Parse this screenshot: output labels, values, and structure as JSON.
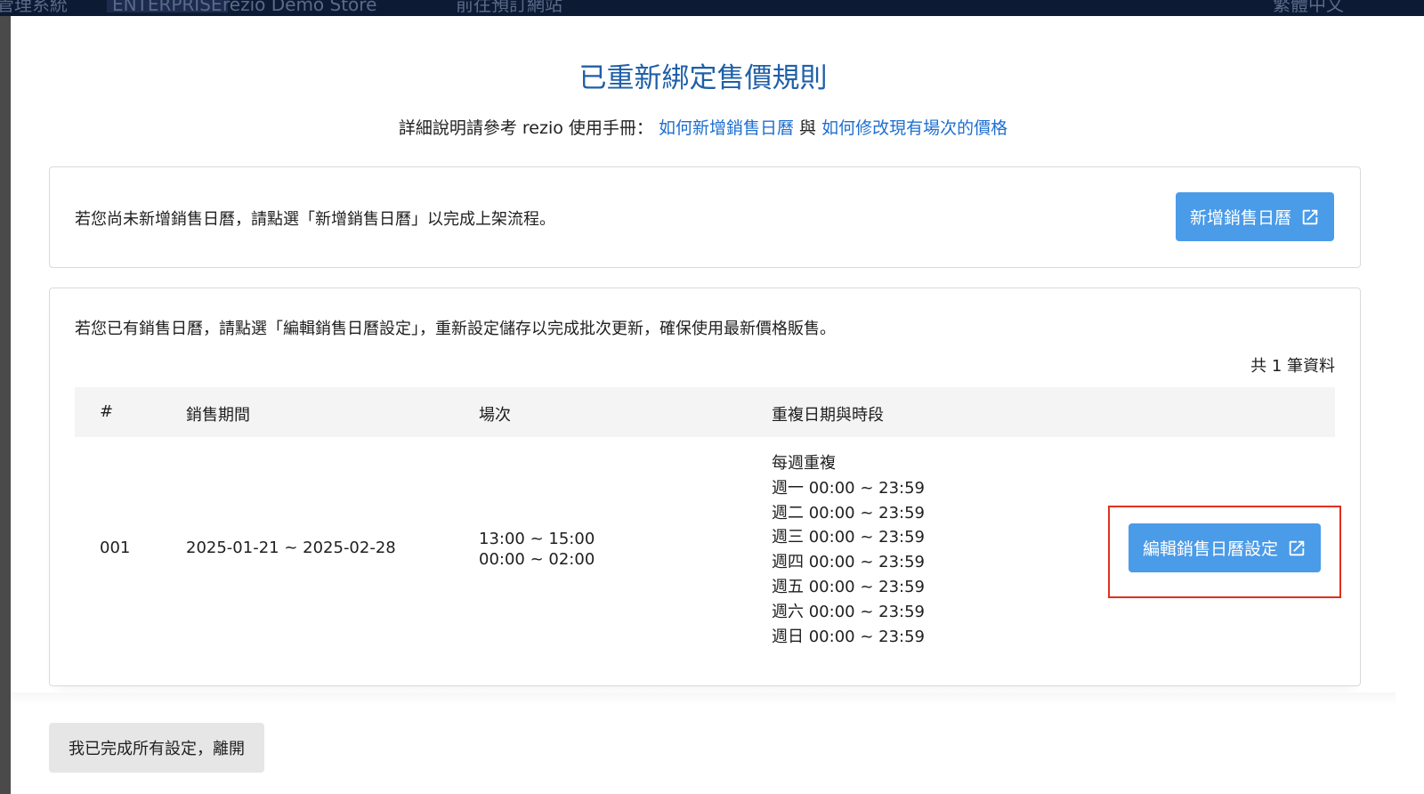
{
  "background": {
    "app_name": "管理系統",
    "plan_badge": "ENTERPRISE",
    "store_name": "rezio Demo Store",
    "goto_site": "前往預訂網站",
    "language": "繁體中文"
  },
  "modal": {
    "title": "已重新綁定售價規則",
    "subtitle_prefix": "詳細說明請參考 rezio 使用手冊：",
    "link_new_calendar": "如何新增銷售日曆",
    "subtitle_and": "與",
    "link_modify_price": "如何修改現有場次的價格"
  },
  "card_new": {
    "text": "若您尚未新增銷售日曆，請點選「新增銷售日曆」以完成上架流程。",
    "button_label": "新增銷售日曆"
  },
  "card_edit": {
    "text": "若您已有銷售日曆，請點選「編輯銷售日曆設定」，重新設定儲存以完成批次更新，確保使用最新價格販售。",
    "count": "共 1 筆資料",
    "columns": [
      "#",
      "銷售期間",
      "場次",
      "重複日期與時段"
    ],
    "row": {
      "num": "001",
      "period": "2025-01-21 ~ 2025-02-28",
      "sessions": [
        "13:00 ~ 15:00",
        "00:00 ~ 02:00"
      ],
      "repeat": [
        "每週重複",
        "週一 00:00 ~ 23:59",
        "週二 00:00 ~ 23:59",
        "週三 00:00 ~ 23:59",
        "週四 00:00 ~ 23:59",
        "週五 00:00 ~ 23:59",
        "週六 00:00 ~ 23:59",
        "週日 00:00 ~ 23:59"
      ],
      "button_label": "編輯銷售日曆設定"
    }
  },
  "footer": {
    "leave_button": "我已完成所有設定，離開"
  },
  "colors": {
    "primary": "#4a9be8",
    "title": "#1f5fa8",
    "link": "#1f6fd0",
    "highlight": "#e0301e"
  }
}
